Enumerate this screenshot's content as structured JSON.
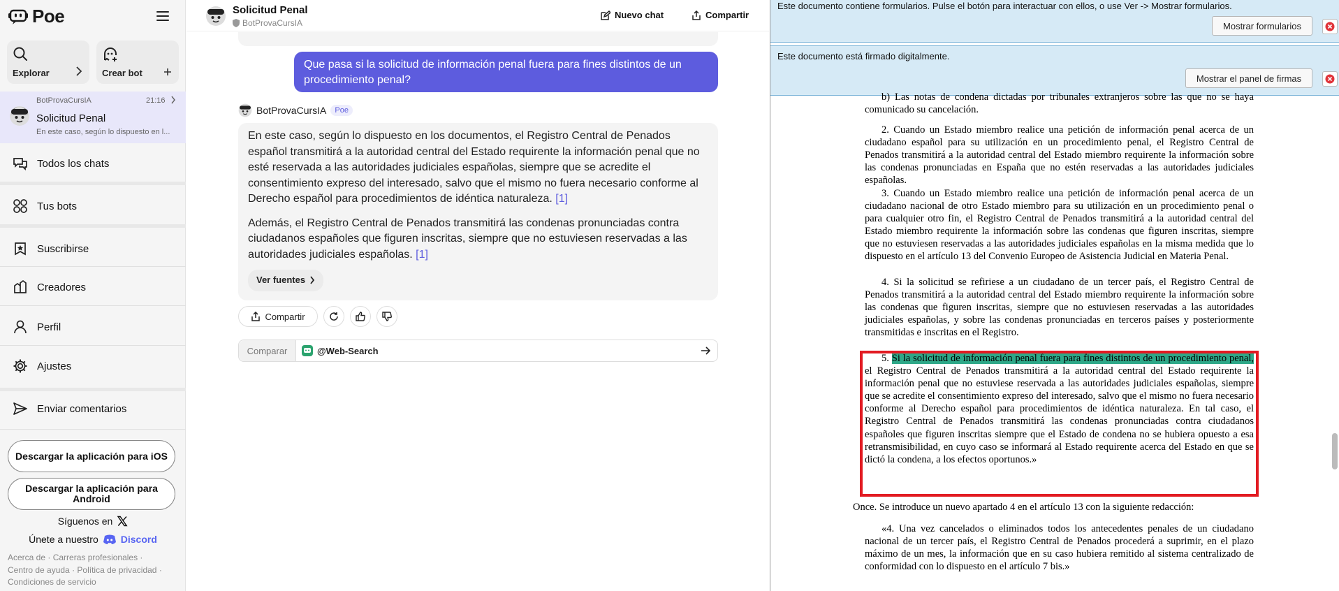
{
  "sidebar": {
    "logo_text": "Poe",
    "tiles": [
      {
        "label": "Explorar",
        "icon": "search-icon"
      },
      {
        "label": "Crear bot",
        "icon": "bot-add-icon"
      }
    ],
    "recent": {
      "bot": "BotProvaCursIA",
      "time": "21:16",
      "title": "Solicitud Penal",
      "preview": "En este caso, según lo dispuesto en l..."
    },
    "nav": [
      {
        "label": "Todos los chats",
        "icon": "chats-icon"
      },
      {
        "label": "Tus bots",
        "icon": "bots-icon"
      },
      {
        "label": "Suscribirse",
        "icon": "subscribe-icon"
      },
      {
        "label": "Creadores",
        "icon": "creators-icon"
      },
      {
        "label": "Perfil",
        "icon": "profile-icon"
      },
      {
        "label": "Ajustes",
        "icon": "gear-icon"
      },
      {
        "label": "Enviar comentarios",
        "icon": "send-icon"
      }
    ],
    "download_ios": "Descargar la aplicación para iOS",
    "download_android": "Descargar la aplicación para Android",
    "follow_text": "Síguenos en",
    "join_text": "Únete a nuestro",
    "discord": "Discord",
    "footer": [
      "Acerca de",
      "Carreras profesionales",
      "Centro de ayuda",
      "Política de privacidad",
      "Condiciones de servicio"
    ]
  },
  "chat": {
    "title": "Solicitud Penal",
    "subtitle": "BotProvaCursIA",
    "new_chat": "Nuevo chat",
    "share": "Compartir",
    "user_message": "Que pasa si la solicitud de información penal fuera para fines distintos de un procedimiento penal?",
    "bot_name": "BotProvaCursIA",
    "bot_badge": "Poe",
    "bot_p1": "En este caso, según lo dispuesto en los documentos, el Registro Central de Penados español transmitirá a la autoridad central del Estado requirente la información penal que no esté reservada a las autoridades judiciales españolas, siempre que se acredite el consentimiento expreso del interesado, salvo que el mismo no fuera necesario conforme al Derecho español para procedimientos de idéntica naturaleza.",
    "bot_p2": "Además, el Registro Central de Penados transmitirá las condenas pronunciadas contra ciudadanos españoles que figuren inscritas, siempre que no estuviesen reservadas a las autoridades judiciales españolas.",
    "cite": "[1]",
    "ver_fuentes": "Ver fuentes",
    "share_action": "Compartir",
    "compare_label": "Comparar",
    "compare_bot": "@Web-Search"
  },
  "pdf": {
    "banner1_text": "Este documento contiene formularios. Pulse el botón para interactuar con ellos, o use Ver -> Mostrar formularios.",
    "banner1_button": "Mostrar formularios",
    "banner2_text": "Este documento está firmado digitalmente.",
    "banner2_button": "Mostrar el panel de firmas",
    "p_b": "b)  Las notas de condena dictadas por tribunales extranjeros sobre las que no se haya comunicado su cancelación.",
    "p2": "2.  Cuando un Estado miembro realice una petición de información penal acerca de un ciudadano español para su utilización en un procedimiento penal, el Registro Central de Penados transmitirá a la autoridad central del Estado miembro requirente la información sobre las condenas pronunciadas en España que no estén reservadas a las autoridades judiciales españolas.",
    "p3": "3.  Cuando un Estado miembro realice una petición de información penal acerca de un ciudadano nacional de otro Estado miembro para su utilización en un procedimiento penal o para cualquier otro fin, el Registro Central de Penados transmitirá a la autoridad central del Estado miembro requirente la información sobre las condenas que figuren inscritas, siempre que no estuviesen reservadas a las autoridades judiciales españolas en la misma medida que lo dispuesto en el artículo 13 del Convenio Europeo de Asistencia Judicial en Materia Penal.",
    "p4": "4.  Si la solicitud se refiriese a un ciudadano de un tercer país, el Registro Central de Penados transmitirá a la autoridad central del Estado miembro requirente la información sobre las condenas que figuren inscritas, siempre que no estuviesen reservadas a las autoridades judiciales españolas, y sobre las condenas pronunciadas en terceros países y posteriormente transmitidas e inscritas en el Registro.",
    "p5_num": "5.",
    "p5_hl": "Si la solicitud de información penal fuera para fines distintos de un procedimiento penal,",
    "p5_rest": "el Registro Central de Penados transmitirá a la autoridad central del Estado requirente la información penal que no estuviese reservada a las autoridades judiciales españolas, siempre que se acredite el consentimiento expreso del interesado, salvo que el mismo no fuera necesario conforme al Derecho español para procedimientos de idéntica naturaleza. En tal caso, el Registro Central de Penados transmitirá las condenas pronunciadas contra ciudadanos españoles que figuren inscritas siempre que el Estado de condena no se hubiera opuesto a esa retransmisibilidad, en cuyo caso se informará al Estado requirente acerca del Estado en que se dictó la condena, a los efectos oportunos.»",
    "once": "Once.   Se introduce un nuevo apartado 4 en el artículo 13 con la siguiente redacción:",
    "p_last": "«4.  Una vez cancelados o eliminados todos los antecedentes penales de un ciudadano nacional de un tercer país, el Registro Central de Penados procederá a suprimir, en el plazo máximo de un mes, la información que en su caso hubiera remitido al sistema centralizado de conformidad con lo dispuesto en el artículo 7 bis.»"
  }
}
